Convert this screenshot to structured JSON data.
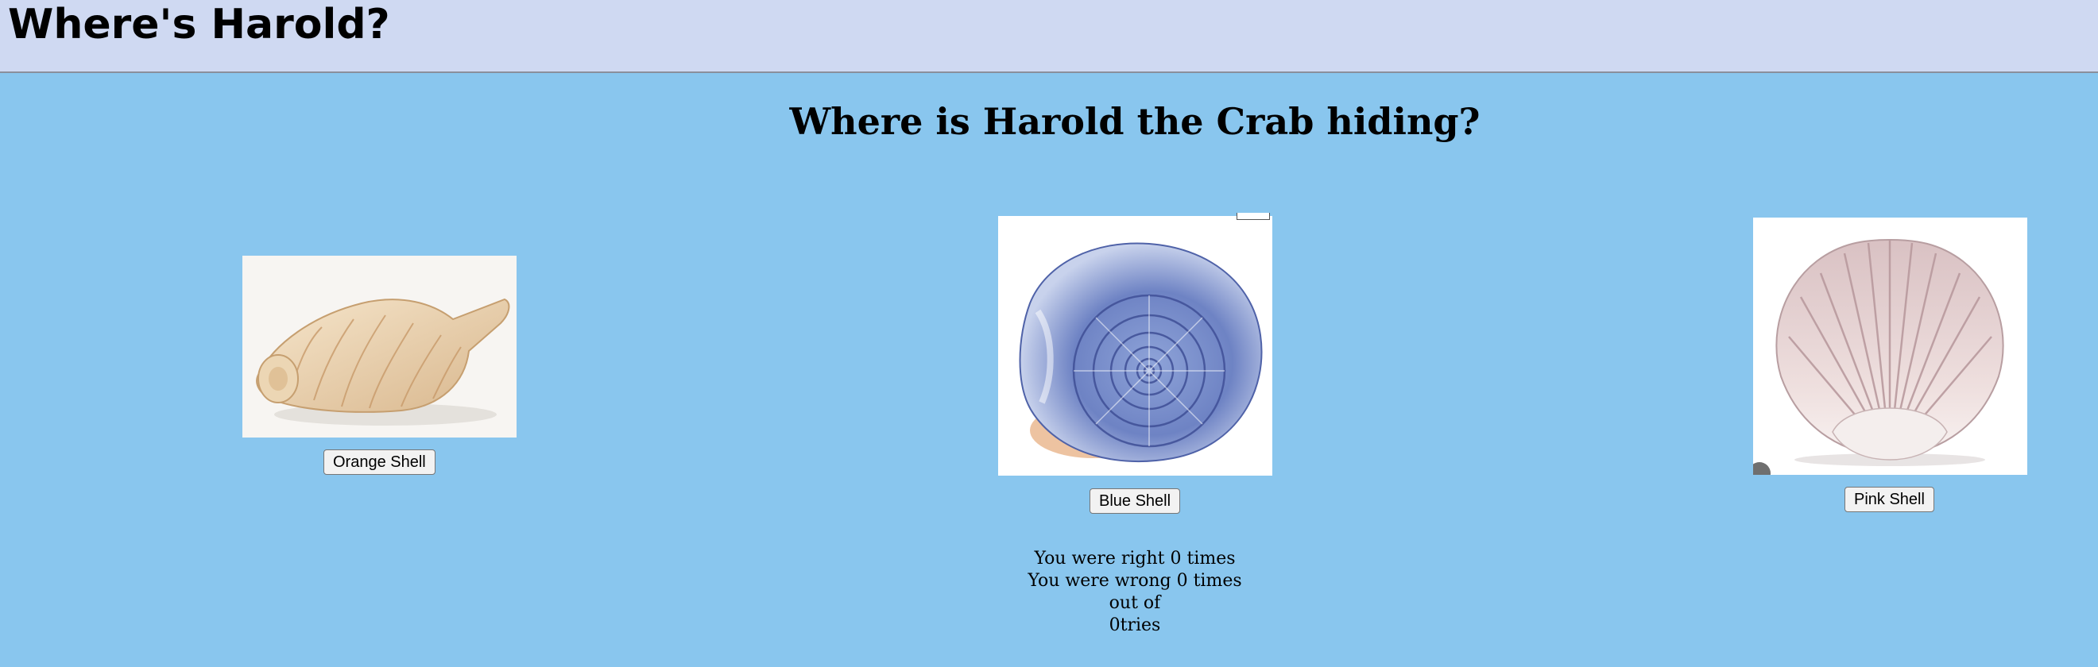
{
  "app": {
    "title": "Where's Harold?"
  },
  "game": {
    "question": "Where is Harold the Crab hiding?",
    "shells": [
      {
        "label": "Orange Shell",
        "image": "orange-shell",
        "color": "#e9d2b0"
      },
      {
        "label": "Blue Shell",
        "image": "blue-shell",
        "color": "#6c84c4"
      },
      {
        "label": "Pink Shell",
        "image": "pink-shell",
        "color": "#e3cfd0"
      }
    ]
  },
  "score": {
    "right": "You were right 0 times",
    "wrong": "You were wrong 0 times",
    "out_of": "out of",
    "tries": "0tries"
  },
  "colors": {
    "page_background": "#89c6ee",
    "header_background": "#cfd9f2"
  }
}
